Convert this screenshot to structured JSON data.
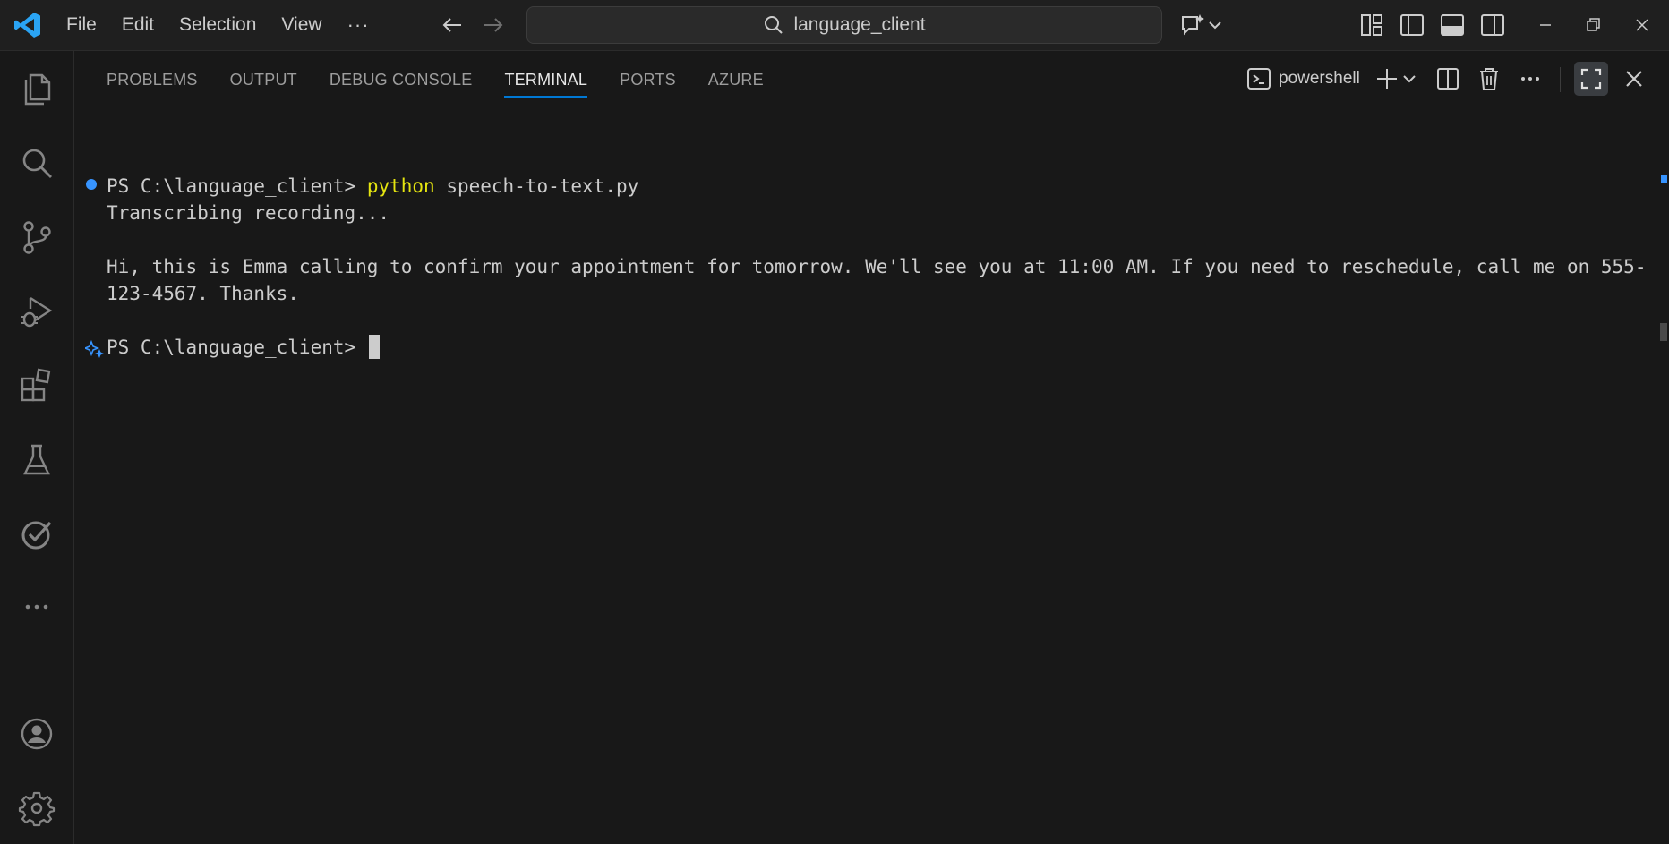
{
  "titlebar": {
    "menu": [
      "File",
      "Edit",
      "Selection",
      "View",
      "···"
    ],
    "search_text": "language_client"
  },
  "panel": {
    "tabs": [
      "PROBLEMS",
      "OUTPUT",
      "DEBUG CONSOLE",
      "TERMINAL",
      "PORTS",
      "AZURE"
    ],
    "active_tab": "TERMINAL",
    "shell_name": "powershell"
  },
  "terminal": {
    "prompt": "PS C:\\language_client>",
    "command_word": "python",
    "command_args": "speech-to-text.py",
    "status_line": "Transcribing recording...",
    "output_line_1": "Hi, this is Emma calling to confirm your appointment for tomorrow. We'll see you at 11:00 AM. If you need to reschedule, call me on 555-",
    "output_line_2": "123-4567. Thanks.",
    "prompt_2": "PS C:\\language_client>"
  },
  "colors": {
    "accent": "#0078d4",
    "logo": "#2aa4f4",
    "command_highlight": "#e5e510",
    "success_dot": "#3794ff"
  },
  "icons": {
    "activity": [
      "explorer-icon",
      "search-icon",
      "source-control-icon",
      "run-debug-icon",
      "extensions-icon",
      "testing-icon",
      "checklist-icon",
      "more-icon",
      "account-icon",
      "settings-icon"
    ]
  }
}
